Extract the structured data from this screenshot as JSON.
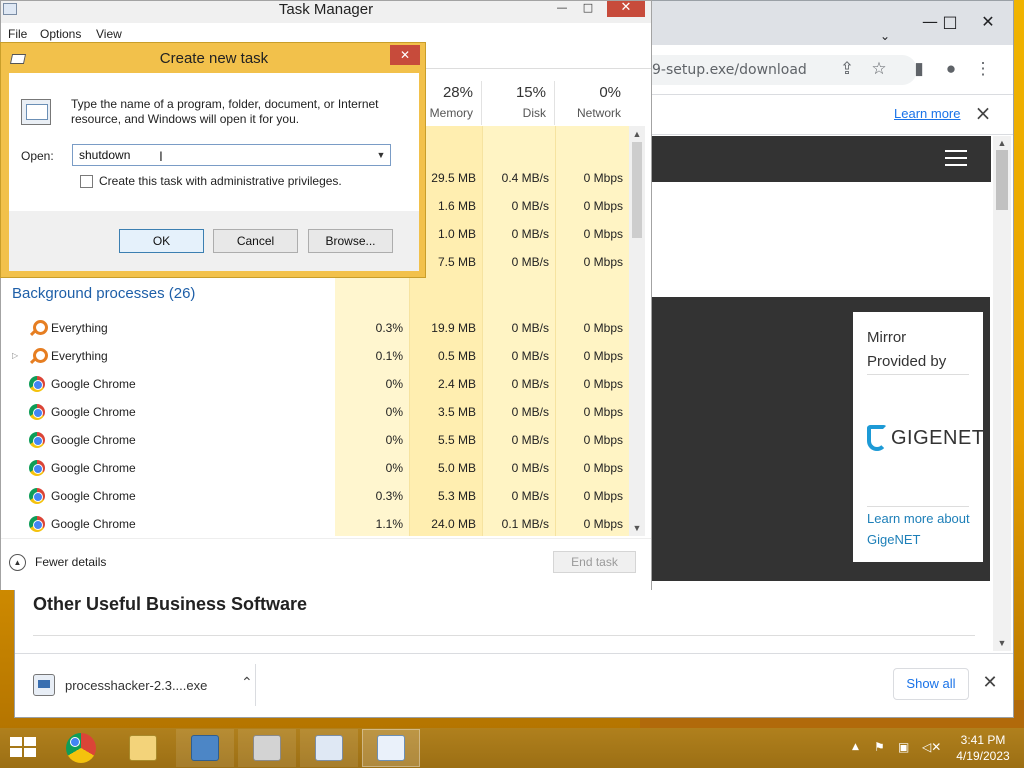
{
  "chrome": {
    "url": "9-setup.exe/download",
    "infobar_link": "Learn more",
    "mirror_title": "Mirror Provided by",
    "mirror_brand": "GIGENET",
    "mirror_link": "Learn more about GigeNET",
    "section_title": "Other Useful Business Software",
    "download_name": "processhacker-2.3....exe",
    "show_all": "Show all"
  },
  "taskmgr": {
    "title": "Task Manager",
    "menu": [
      "File",
      "Options",
      "View"
    ],
    "columns": [
      {
        "pct": "28%",
        "name": "Memory"
      },
      {
        "pct": "15%",
        "name": "Disk"
      },
      {
        "pct": "0%",
        "name": "Network"
      }
    ],
    "top_rows": [
      {
        "memory": "29.5 MB",
        "disk": "0.4 MB/s",
        "network": "0 Mbps"
      },
      {
        "memory": "1.6 MB",
        "disk": "0 MB/s",
        "network": "0 Mbps"
      },
      {
        "memory": "1.0 MB",
        "disk": "0 MB/s",
        "network": "0 Mbps"
      },
      {
        "memory": "7.5 MB",
        "disk": "0 MB/s",
        "network": "0 Mbps"
      }
    ],
    "group_title": "Background processes (26)",
    "processes": [
      {
        "name": "Everything",
        "icon": "search-icon",
        "cpu": "0.3%",
        "memory": "19.9 MB",
        "disk": "0 MB/s",
        "network": "0 Mbps"
      },
      {
        "name": "Everything",
        "icon": "search-icon",
        "cpu": "0.1%",
        "memory": "0.5 MB",
        "disk": "0 MB/s",
        "network": "0 Mbps"
      },
      {
        "name": "Google Chrome",
        "icon": "chrome-icon",
        "cpu": "0%",
        "memory": "2.4 MB",
        "disk": "0 MB/s",
        "network": "0 Mbps"
      },
      {
        "name": "Google Chrome",
        "icon": "chrome-icon",
        "cpu": "0%",
        "memory": "3.5 MB",
        "disk": "0 MB/s",
        "network": "0 Mbps"
      },
      {
        "name": "Google Chrome",
        "icon": "chrome-icon",
        "cpu": "0%",
        "memory": "5.5 MB",
        "disk": "0 MB/s",
        "network": "0 Mbps"
      },
      {
        "name": "Google Chrome",
        "icon": "chrome-icon",
        "cpu": "0%",
        "memory": "5.0 MB",
        "disk": "0 MB/s",
        "network": "0 Mbps"
      },
      {
        "name": "Google Chrome",
        "icon": "chrome-icon",
        "cpu": "0.3%",
        "memory": "5.3 MB",
        "disk": "0 MB/s",
        "network": "0 Mbps"
      },
      {
        "name": "Google Chrome",
        "icon": "chrome-icon",
        "cpu": "1.1%",
        "memory": "24.0 MB",
        "disk": "0.1 MB/s",
        "network": "0 Mbps"
      }
    ],
    "fewer_details": "Fewer details",
    "end_task": "End task"
  },
  "run_dialog": {
    "title": "Create new task",
    "description": "Type the name of a program, folder, document, or Internet resource, and Windows will open it for you.",
    "open_label": "Open:",
    "open_value": "shutdown",
    "admin_label": "Create this task with administrative privileges.",
    "ok": "OK",
    "cancel": "Cancel",
    "browse": "Browse..."
  },
  "taskbar": {
    "time": "3:41 PM",
    "date": "4/19/2023"
  },
  "colors": {
    "heat_light": "#fff4c4",
    "heat_mid": "#ffe9a0",
    "accent_blue": "#1a73e8",
    "close_red": "#c74b3b"
  }
}
